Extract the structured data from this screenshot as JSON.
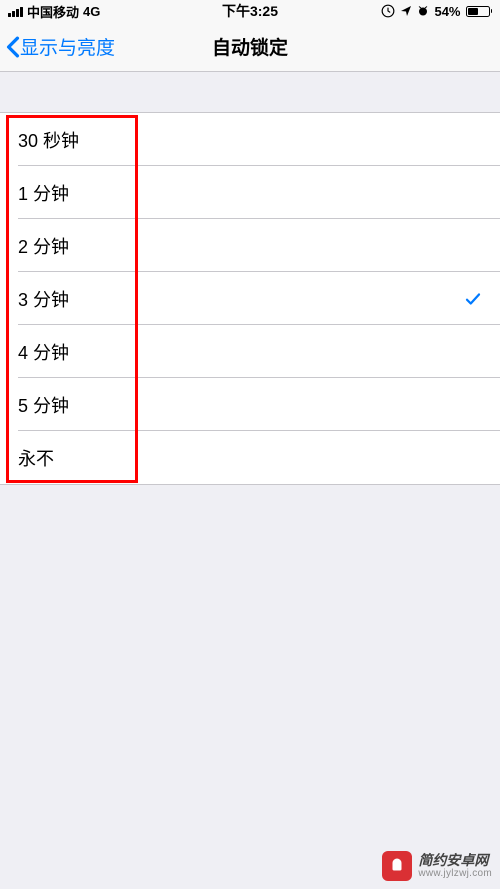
{
  "status": {
    "carrier": "中国移动",
    "network": "4G",
    "time": "下午3:25",
    "battery_pct": "54%"
  },
  "nav": {
    "back_label": "显示与亮度",
    "title": "自动锁定"
  },
  "options": [
    {
      "label": "30 秒钟",
      "selected": false
    },
    {
      "label": "1 分钟",
      "selected": false
    },
    {
      "label": "2 分钟",
      "selected": false
    },
    {
      "label": "3 分钟",
      "selected": true
    },
    {
      "label": "4 分钟",
      "selected": false
    },
    {
      "label": "5 分钟",
      "selected": false
    },
    {
      "label": "永不",
      "selected": false
    }
  ],
  "watermark": {
    "title": "简约安卓网",
    "url": "www.jylzwj.com"
  }
}
